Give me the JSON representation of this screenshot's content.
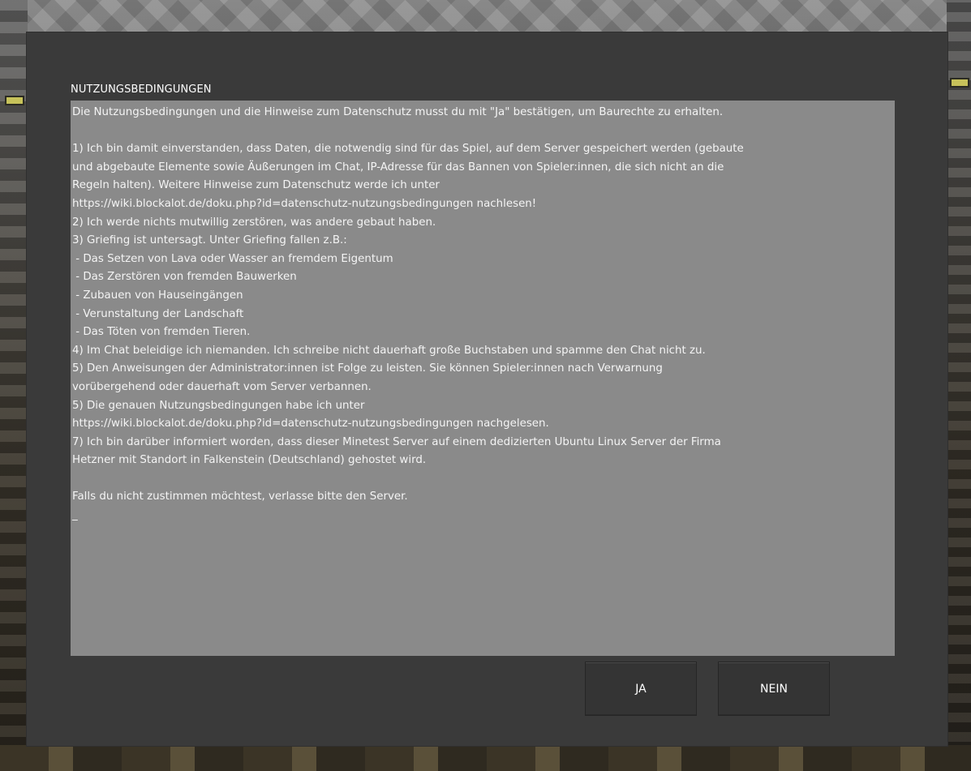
{
  "dialog": {
    "title": "NUTZUNGSBEDINGUNGEN",
    "lines": [
      "Die Nutzungsbedingungen und die Hinweise zum Datenschutz musst du mit \"Ja\" bestätigen, um Baurechte zu erhalten.",
      "",
      "1) Ich bin damit einverstanden, dass Daten, die notwendig sind für das Spiel, auf dem Server gespeichert werden (gebaute",
      "und abgebaute Elemente sowie Äußerungen im Chat, IP-Adresse für das Bannen von Spieler:innen, die sich nicht an die",
      "Regeln halten). Weitere Hinweise zum Datenschutz werde ich unter",
      "https://wiki.blockalot.de/doku.php?id=datenschutz-nutzungsbedingungen nachlesen!",
      "2) Ich werde nichts mutwillig zerstören, was andere gebaut haben.",
      "3) Griefing ist untersagt. Unter Griefing fallen z.B.:",
      " - Das Setzen von Lava oder Wasser an fremdem Eigentum",
      " - Das Zerstören von fremden Bauwerken",
      " - Zubauen von Hauseingängen",
      " - Verunstaltung der Landschaft",
      " - Das Töten von fremden Tieren.",
      "4) Im Chat beleidige ich niemanden. Ich schreibe nicht dauerhaft große Buchstaben und spamme den Chat nicht zu.",
      "5) Den Anweisungen der Administrator:innen ist Folge zu leisten. Sie können Spieler:innen nach Verwarnung",
      "vorübergehend oder dauerhaft vom Server verbannen.",
      "5) Die genauen Nutzungsbedingungen habe ich unter",
      "https://wiki.blockalot.de/doku.php?id=datenschutz-nutzungsbedingungen nachgelesen.",
      "7) Ich bin darüber informiert worden, dass dieser Minetest Server auf einem dedizierten Ubuntu Linux Server der Firma",
      "Hetzner mit Standort in Falkenstein (Deutschland) gehostet wird.",
      "",
      "Falls du nicht zustimmen möchtest, verlasse bitte den Server."
    ],
    "cursor": "_",
    "accept_label": "JA",
    "decline_label": "NEIN"
  },
  "colors": {
    "dialog_bg": "#3a3a3a",
    "textarea_bg": "#8a8a8a",
    "button_bg": "#343434",
    "text": "#ffffff"
  }
}
